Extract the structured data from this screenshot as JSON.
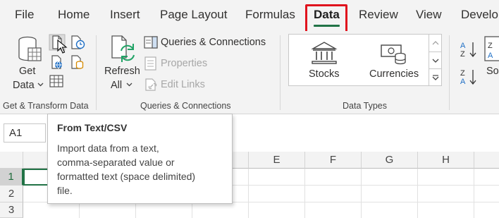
{
  "tabs": {
    "file": "File",
    "home": "Home",
    "insert": "Insert",
    "page_layout": "Page Layout",
    "formulas": "Formulas",
    "data": "Data",
    "review": "Review",
    "view": "View",
    "developer": "Develop"
  },
  "ribbon": {
    "get_transform": {
      "get_data_line1": "Get",
      "get_data_line2": "Data",
      "group_label": "Get & Transform Data"
    },
    "queries": {
      "refresh_line1": "Refresh",
      "refresh_line2": "All",
      "queries_connections": "Queries & Connections",
      "properties": "Properties",
      "edit_links": "Edit Links",
      "group_label": "Queries & Connections"
    },
    "data_types": {
      "stocks": "Stocks",
      "currencies": "Currencies",
      "group_label": "Data Types"
    },
    "sort": {
      "sort_label": "So"
    }
  },
  "name_box": {
    "value": "A1"
  },
  "grid": {
    "columns": [
      "E",
      "F",
      "G",
      "H"
    ],
    "rows": [
      "1",
      "2",
      "3"
    ]
  },
  "tooltip": {
    "title": "From Text/CSV",
    "body": "Import data from a text,\ncomma-separated value or\nformatted text (space delimited)\nfile."
  },
  "colors": {
    "accent_green": "#217346",
    "highlight_red": "#e0131d"
  }
}
